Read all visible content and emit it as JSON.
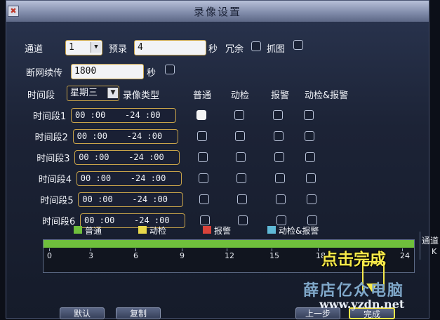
{
  "window": {
    "title": "录像设置",
    "close_glyph": "✖"
  },
  "channel": {
    "label": "通道",
    "value": "1"
  },
  "prerecord": {
    "label": "预录",
    "value": "4",
    "unit": "秒"
  },
  "redundancy": {
    "label": "冗余",
    "checked": false
  },
  "snapshot": {
    "label": "抓图",
    "checked": false
  },
  "resume": {
    "label": "断网续传",
    "value": "1800",
    "unit": "秒",
    "checked": false
  },
  "period": {
    "label": "时间段",
    "value": "星期三"
  },
  "columns": {
    "rec_type": "录像类型",
    "normal": "普通",
    "motion": "动检",
    "alarm": "报警",
    "motion_alarm": "动检&报警"
  },
  "segments": [
    {
      "label": "时间段1",
      "start": "00 :00",
      "end": "-24 :00",
      "normal": true,
      "motion": false,
      "alarm": false,
      "motion_alarm": false
    },
    {
      "label": "时间段2",
      "start": "00 :00",
      "end": "-24 :00",
      "normal": false,
      "motion": false,
      "alarm": false,
      "motion_alarm": false
    },
    {
      "label": "时间段3",
      "start": "00 :00",
      "end": "-24 :00",
      "normal": false,
      "motion": false,
      "alarm": false,
      "motion_alarm": false
    },
    {
      "label": "时间段4",
      "start": "00 :00",
      "end": "-24 :00",
      "normal": false,
      "motion": false,
      "alarm": false,
      "motion_alarm": false
    },
    {
      "label": "时间段5",
      "start": "00 :00",
      "end": "-24 :00",
      "normal": false,
      "motion": false,
      "alarm": false,
      "motion_alarm": false
    },
    {
      "label": "时间段6",
      "start": "00 :00",
      "end": "-24 :00",
      "normal": false,
      "motion": false,
      "alarm": false,
      "motion_alarm": false
    }
  ],
  "legend": [
    {
      "label": "普通",
      "color": "#6fbf3c"
    },
    {
      "label": "动检",
      "color": "#e8d84a"
    },
    {
      "label": "报警",
      "color": "#d9423a"
    },
    {
      "label": "动检&报警",
      "color": "#5fb9d6"
    }
  ],
  "timeline": {
    "ticks": [
      "0",
      "3",
      "6",
      "9",
      "12",
      "15",
      "18",
      "24"
    ]
  },
  "buttons": {
    "default": "默认",
    "copy": "复制",
    "prev": "上一步",
    "finish": "完成"
  },
  "overlay": {
    "click_finish": "点击完成"
  },
  "watermark": {
    "brand": "薛店亿众电脑",
    "url": "www.yzdn.net"
  },
  "side": {
    "text1": "通道",
    "text2": "K"
  }
}
